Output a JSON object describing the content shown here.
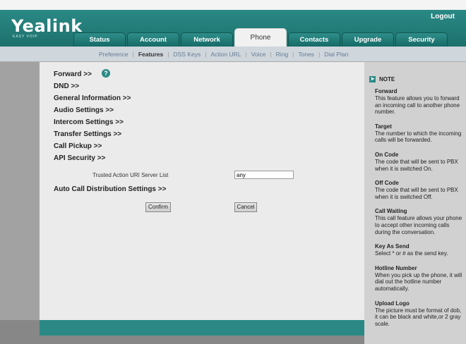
{
  "brand": {
    "name": "Yealink",
    "tagline": "EASY VOIP"
  },
  "header": {
    "logout": "Logout"
  },
  "tabs": [
    "Status",
    "Account",
    "Network",
    "Phone",
    "Contacts",
    "Upgrade",
    "Security"
  ],
  "active_tab": "Phone",
  "subnav": [
    "Preference",
    "Features",
    "DSS Keys",
    "Action URL",
    "Voice",
    "Ring",
    "Tones",
    "Dial Plan"
  ],
  "active_subnav": "Features",
  "sections": [
    "Forward >>",
    "DND >>",
    "General Information >>",
    "Audio Settings >>",
    "Intercom Settings >>",
    "Transfer Settings >>",
    "Call Pickup >>",
    "API Security >>",
    "Auto Call Distribution Settings >>"
  ],
  "help_icon": "?",
  "trusted": {
    "label": "Trusted Action URI Server List",
    "value": "any"
  },
  "buttons": {
    "confirm": "Confirm",
    "cancel": "Cancel"
  },
  "note": {
    "title": "NOTE",
    "items": [
      {
        "title": "Forward",
        "text": "This feature allows you to forward an incoming call to another phone number."
      },
      {
        "title": "Target",
        "text": "The number to which the incoming calls will be forwarded."
      },
      {
        "title": "On Code",
        "text": "The code that will be sent to PBX when it is switched On."
      },
      {
        "title": "Off Code",
        "text": "The code that will be sent to PBX when it is switched Off."
      },
      {
        "title": "Call Waiting",
        "text": "This call feature allows your phone to accept other incoming calls during the conversation."
      },
      {
        "title": "Key As Send",
        "text": "Select * or # as the send key."
      },
      {
        "title": "Hotline Number",
        "text": "When you pick up the phone, it will dial out the hotline number automatically."
      },
      {
        "title": "Upload Logo",
        "text": "The picture must be format of dob, it can be black and white,or 2 gray scale."
      }
    ]
  },
  "colors": {
    "brand_teal": "#2a8985",
    "subnav_link": "#637c93"
  }
}
